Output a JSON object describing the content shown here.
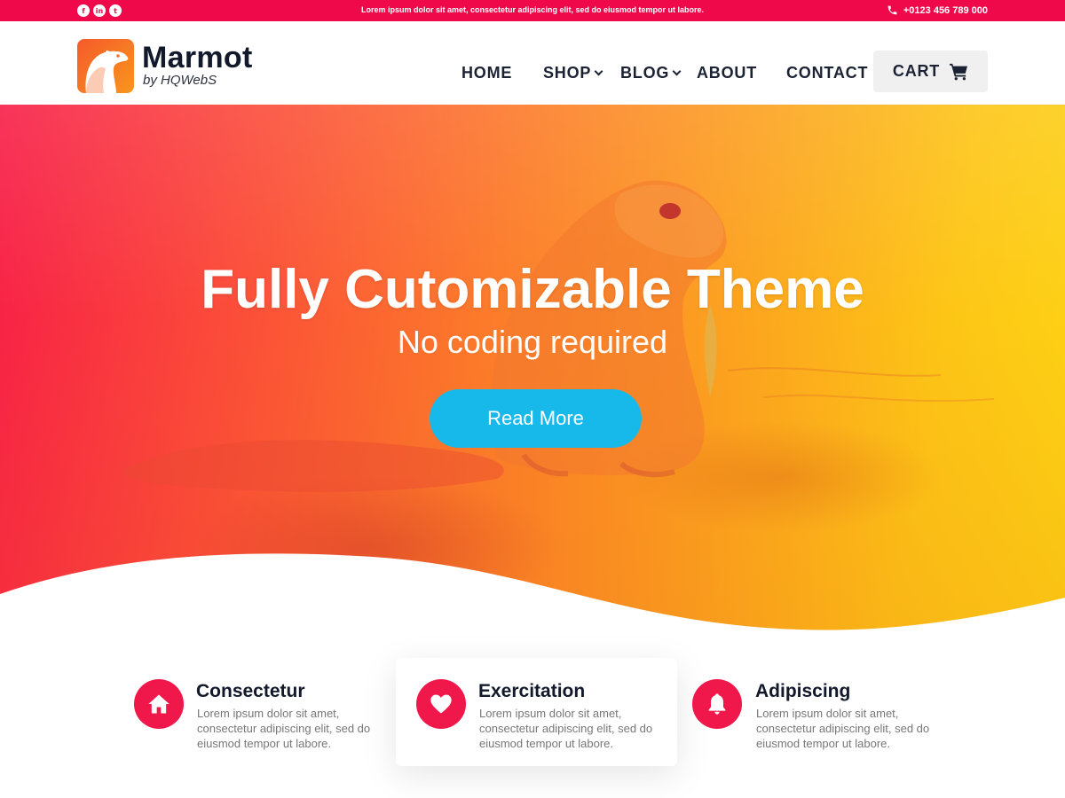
{
  "colors": {
    "accent": "#f0094a",
    "button": "#17b9ea",
    "dark_text": "#12192b"
  },
  "topbar": {
    "social_icons": [
      "facebook-icon",
      "linkedin-icon",
      "twitter-icon"
    ],
    "social_glyphs": {
      "facebook": "f",
      "linkedin": "in",
      "twitter": "t"
    },
    "tagline": "Lorem ipsum dolor sit amet, consectetur adipiscing elit, sed do eiusmod tempor ut labore.",
    "phone": "+0123 456 789 000"
  },
  "header": {
    "logo_title": "Marmot",
    "logo_subtitle": "by HQWebS",
    "nav": {
      "home": "HOME",
      "shop": "SHOP",
      "blog": "BLOG",
      "about": "ABOUT",
      "contact": "CONTACT"
    },
    "cart": "CART"
  },
  "hero": {
    "title": "Fully Cutomizable Theme",
    "subtitle": "No coding required",
    "button": "Read More"
  },
  "features": [
    {
      "icon": "home-icon",
      "title": "Consectetur",
      "text": "Lorem ipsum dolor sit amet, consectetur adipiscing elit, sed do eiusmod tempor ut labore."
    },
    {
      "icon": "heart-icon",
      "title": "Exercitation",
      "text": "Lorem ipsum dolor sit amet, consectetur adipiscing elit, sed do eiusmod tempor ut labore."
    },
    {
      "icon": "bell-icon",
      "title": "Adipiscing",
      "text": "Lorem ipsum dolor sit amet, consectetur adipiscing elit, sed do eiusmod tempor ut labore."
    }
  ]
}
